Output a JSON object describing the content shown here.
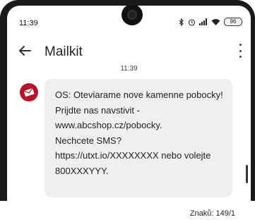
{
  "status": {
    "time": "11:39",
    "battery": "96",
    "icons": [
      "bluetooth-icon",
      "alarm-icon",
      "signal-icon",
      "wifi-icon",
      "battery-icon"
    ]
  },
  "appbar": {
    "title": "Mailkit"
  },
  "message": {
    "timestamp": "11:39",
    "lines": [
      "OS: Oteviarame nove kamenne pobocky!",
      "Prijdte nas navstivit -",
      "www.abcshop.cz/pobocky.",
      "Nechcete SMS?",
      "https://utxt.io/XXXXXXXX nebo volejte",
      "800XXXYYY."
    ]
  },
  "footer": {
    "char_count": "Znaků: 149/1"
  },
  "colors": {
    "avatar": "#b3152d",
    "bubble": "#efefef"
  }
}
